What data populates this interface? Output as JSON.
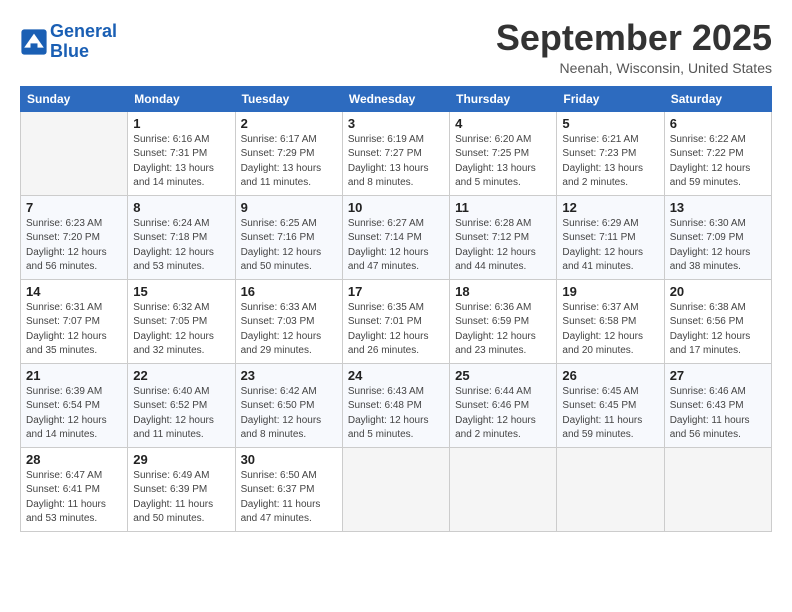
{
  "logo": {
    "line1": "General",
    "line2": "Blue"
  },
  "title": "September 2025",
  "location": "Neenah, Wisconsin, United States",
  "headers": [
    "Sunday",
    "Monday",
    "Tuesday",
    "Wednesday",
    "Thursday",
    "Friday",
    "Saturday"
  ],
  "weeks": [
    [
      {
        "day": "",
        "sunrise": "",
        "sunset": "",
        "daylight": ""
      },
      {
        "day": "1",
        "sunrise": "Sunrise: 6:16 AM",
        "sunset": "Sunset: 7:31 PM",
        "daylight": "Daylight: 13 hours and 14 minutes."
      },
      {
        "day": "2",
        "sunrise": "Sunrise: 6:17 AM",
        "sunset": "Sunset: 7:29 PM",
        "daylight": "Daylight: 13 hours and 11 minutes."
      },
      {
        "day": "3",
        "sunrise": "Sunrise: 6:19 AM",
        "sunset": "Sunset: 7:27 PM",
        "daylight": "Daylight: 13 hours and 8 minutes."
      },
      {
        "day": "4",
        "sunrise": "Sunrise: 6:20 AM",
        "sunset": "Sunset: 7:25 PM",
        "daylight": "Daylight: 13 hours and 5 minutes."
      },
      {
        "day": "5",
        "sunrise": "Sunrise: 6:21 AM",
        "sunset": "Sunset: 7:23 PM",
        "daylight": "Daylight: 13 hours and 2 minutes."
      },
      {
        "day": "6",
        "sunrise": "Sunrise: 6:22 AM",
        "sunset": "Sunset: 7:22 PM",
        "daylight": "Daylight: 12 hours and 59 minutes."
      }
    ],
    [
      {
        "day": "7",
        "sunrise": "Sunrise: 6:23 AM",
        "sunset": "Sunset: 7:20 PM",
        "daylight": "Daylight: 12 hours and 56 minutes."
      },
      {
        "day": "8",
        "sunrise": "Sunrise: 6:24 AM",
        "sunset": "Sunset: 7:18 PM",
        "daylight": "Daylight: 12 hours and 53 minutes."
      },
      {
        "day": "9",
        "sunrise": "Sunrise: 6:25 AM",
        "sunset": "Sunset: 7:16 PM",
        "daylight": "Daylight: 12 hours and 50 minutes."
      },
      {
        "day": "10",
        "sunrise": "Sunrise: 6:27 AM",
        "sunset": "Sunset: 7:14 PM",
        "daylight": "Daylight: 12 hours and 47 minutes."
      },
      {
        "day": "11",
        "sunrise": "Sunrise: 6:28 AM",
        "sunset": "Sunset: 7:12 PM",
        "daylight": "Daylight: 12 hours and 44 minutes."
      },
      {
        "day": "12",
        "sunrise": "Sunrise: 6:29 AM",
        "sunset": "Sunset: 7:11 PM",
        "daylight": "Daylight: 12 hours and 41 minutes."
      },
      {
        "day": "13",
        "sunrise": "Sunrise: 6:30 AM",
        "sunset": "Sunset: 7:09 PM",
        "daylight": "Daylight: 12 hours and 38 minutes."
      }
    ],
    [
      {
        "day": "14",
        "sunrise": "Sunrise: 6:31 AM",
        "sunset": "Sunset: 7:07 PM",
        "daylight": "Daylight: 12 hours and 35 minutes."
      },
      {
        "day": "15",
        "sunrise": "Sunrise: 6:32 AM",
        "sunset": "Sunset: 7:05 PM",
        "daylight": "Daylight: 12 hours and 32 minutes."
      },
      {
        "day": "16",
        "sunrise": "Sunrise: 6:33 AM",
        "sunset": "Sunset: 7:03 PM",
        "daylight": "Daylight: 12 hours and 29 minutes."
      },
      {
        "day": "17",
        "sunrise": "Sunrise: 6:35 AM",
        "sunset": "Sunset: 7:01 PM",
        "daylight": "Daylight: 12 hours and 26 minutes."
      },
      {
        "day": "18",
        "sunrise": "Sunrise: 6:36 AM",
        "sunset": "Sunset: 6:59 PM",
        "daylight": "Daylight: 12 hours and 23 minutes."
      },
      {
        "day": "19",
        "sunrise": "Sunrise: 6:37 AM",
        "sunset": "Sunset: 6:58 PM",
        "daylight": "Daylight: 12 hours and 20 minutes."
      },
      {
        "day": "20",
        "sunrise": "Sunrise: 6:38 AM",
        "sunset": "Sunset: 6:56 PM",
        "daylight": "Daylight: 12 hours and 17 minutes."
      }
    ],
    [
      {
        "day": "21",
        "sunrise": "Sunrise: 6:39 AM",
        "sunset": "Sunset: 6:54 PM",
        "daylight": "Daylight: 12 hours and 14 minutes."
      },
      {
        "day": "22",
        "sunrise": "Sunrise: 6:40 AM",
        "sunset": "Sunset: 6:52 PM",
        "daylight": "Daylight: 12 hours and 11 minutes."
      },
      {
        "day": "23",
        "sunrise": "Sunrise: 6:42 AM",
        "sunset": "Sunset: 6:50 PM",
        "daylight": "Daylight: 12 hours and 8 minutes."
      },
      {
        "day": "24",
        "sunrise": "Sunrise: 6:43 AM",
        "sunset": "Sunset: 6:48 PM",
        "daylight": "Daylight: 12 hours and 5 minutes."
      },
      {
        "day": "25",
        "sunrise": "Sunrise: 6:44 AM",
        "sunset": "Sunset: 6:46 PM",
        "daylight": "Daylight: 12 hours and 2 minutes."
      },
      {
        "day": "26",
        "sunrise": "Sunrise: 6:45 AM",
        "sunset": "Sunset: 6:45 PM",
        "daylight": "Daylight: 11 hours and 59 minutes."
      },
      {
        "day": "27",
        "sunrise": "Sunrise: 6:46 AM",
        "sunset": "Sunset: 6:43 PM",
        "daylight": "Daylight: 11 hours and 56 minutes."
      }
    ],
    [
      {
        "day": "28",
        "sunrise": "Sunrise: 6:47 AM",
        "sunset": "Sunset: 6:41 PM",
        "daylight": "Daylight: 11 hours and 53 minutes."
      },
      {
        "day": "29",
        "sunrise": "Sunrise: 6:49 AM",
        "sunset": "Sunset: 6:39 PM",
        "daylight": "Daylight: 11 hours and 50 minutes."
      },
      {
        "day": "30",
        "sunrise": "Sunrise: 6:50 AM",
        "sunset": "Sunset: 6:37 PM",
        "daylight": "Daylight: 11 hours and 47 minutes."
      },
      {
        "day": "",
        "sunrise": "",
        "sunset": "",
        "daylight": ""
      },
      {
        "day": "",
        "sunrise": "",
        "sunset": "",
        "daylight": ""
      },
      {
        "day": "",
        "sunrise": "",
        "sunset": "",
        "daylight": ""
      },
      {
        "day": "",
        "sunrise": "",
        "sunset": "",
        "daylight": ""
      }
    ]
  ]
}
